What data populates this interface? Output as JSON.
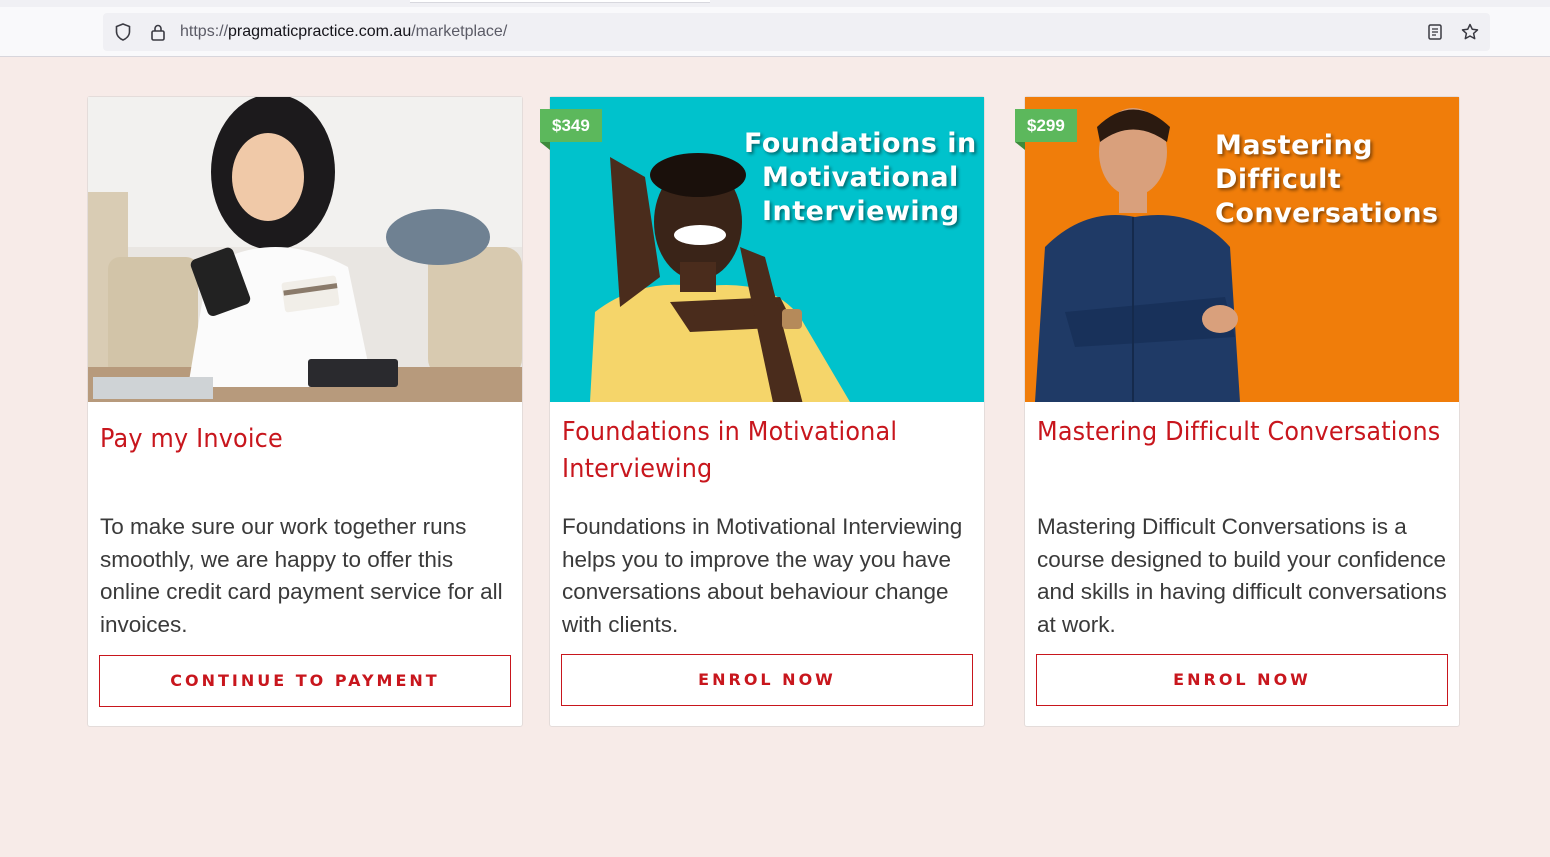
{
  "browser": {
    "url_scheme": "https://",
    "url_host": "pragmaticpractice.com.au",
    "url_path": "/marketplace/"
  },
  "cards": [
    {
      "title": "Pay my Invoice",
      "description": "To make sure our work together runs smoothly, we are happy to offer this online credit card payment service for all invoices.",
      "button": "CONTINUE TO PAYMENT"
    },
    {
      "price": "$349",
      "hero_text": [
        "Foundations in",
        "Motivational",
        "Interviewing"
      ],
      "title": "Foundations in Motivational Interviewing",
      "description": "Foundations in Motivational Interviewing helps you to improve the way you have conversations about behaviour change with clients.",
      "button": "ENROL NOW"
    },
    {
      "price": "$299",
      "hero_text": [
        "Mastering",
        "Difficult",
        "Conversations"
      ],
      "title": "Mastering Difficult Conversations",
      "description": "Mastering Difficult Conversations is a course designed to build your confidence and skills in having difficult conversations at work.",
      "button": "ENROL NOW"
    }
  ],
  "colors": {
    "accent": "#c8161d",
    "price_badge": "#5cb85c",
    "teal": "#00c2cc",
    "orange": "#f07d0a",
    "page_bg": "#f7ebe8"
  }
}
